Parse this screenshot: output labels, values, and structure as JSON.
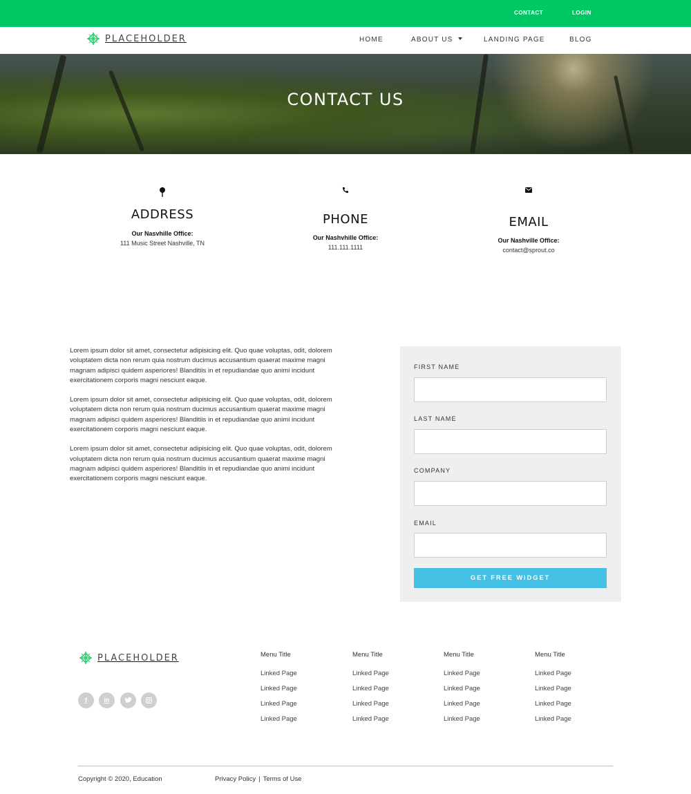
{
  "topbar": {
    "contact": "CONTACT",
    "login": "LOGIN",
    "color": "#00c864"
  },
  "brand": {
    "name": "PLACEHOLDER",
    "accent": "#2ecc71"
  },
  "nav": {
    "home": "HOME",
    "about": "ABOUT US",
    "landing": "LANDING PAGE",
    "blog": "BLOG"
  },
  "hero": {
    "title": "CONTACT US"
  },
  "info": [
    {
      "icon": "map-pin-icon",
      "title": "ADDRESS",
      "label": "Our Nasvhille Office:",
      "value": "111 Music Street Nashville, TN"
    },
    {
      "icon": "phone-icon",
      "title": "PHONE",
      "label": "Our Nashvhille Office:",
      "value": "111.111.1111"
    },
    {
      "icon": "envelope-icon",
      "title": "EMAIL",
      "label": "Our Nashville Office:",
      "value": "contact@sprout.co"
    }
  ],
  "copy": {
    "p1": "Lorem ipsum dolor sit amet, consectetur adipisicing elit. Quo quae voluptas, odit, dolorem voluptatem dicta non rerum quia nostrum ducimus accusantium quaerat maxime magni magnam adipisci quidem asperiores! Blanditiis in et repudiandae quo animi incidunt exercitationem corporis magni nesciunt eaque.",
    "p2": "Lorem ipsum dolor sit amet, consectetur adipisicing elit. Quo quae voluptas, odit, dolorem voluptatem dicta non rerum quia nostrum ducimus accusantium quaerat maxime magni magnam adipisci quidem asperiores! Blanditiis in et repudiandae quo animi incidunt exercitationem corporis magni nesciunt eaque.",
    "p3": "Lorem ipsum dolor sit amet, consectetur adipisicing elit. Quo quae voluptas, odit, dolorem voluptatem dicta non rerum quia nostrum ducimus accusantium quaerat maxime magni magnam adipisci quidem asperiores! Blanditiis in et repudiandae quo animi incidunt exercitationem corporis magni nesciunt eaque."
  },
  "form": {
    "first_name_label": "FIRST NAME",
    "first_name_value": "",
    "last_name_label": "LAST NAME",
    "last_name_value": "",
    "company_label": "COMPANY",
    "company_value": "",
    "email_label": "EMAIL",
    "email_value": "",
    "submit": "GET FREE WIDGET",
    "button_color": "#44c0e4"
  },
  "footer": {
    "social": [
      {
        "icon": "facebook-icon",
        "glyph": "f"
      },
      {
        "icon": "linkedin-icon",
        "glyph": "in"
      },
      {
        "icon": "twitter-icon",
        "glyph": ""
      },
      {
        "icon": "instagram-icon",
        "glyph": ""
      }
    ],
    "columns": [
      {
        "title": "Menu Title",
        "links": [
          "Linked Page",
          "Linked Page",
          "Linked Page",
          "Linked Page"
        ]
      },
      {
        "title": "Menu Title",
        "links": [
          "Linked Page",
          "Linked Page",
          "Linked Page",
          "Linked Page"
        ]
      },
      {
        "title": "Menu Title",
        "links": [
          "Linked Page",
          "Linked Page",
          "Linked Page",
          "Linked Page"
        ]
      },
      {
        "title": "Menu Title",
        "links": [
          "Linked Page",
          "Linked Page",
          "Linked Page",
          "Linked Page"
        ]
      }
    ],
    "copyright": "Copyright © 2020, Education",
    "privacy": "Privacy Policy",
    "separator": "|",
    "terms": "Terms of Use"
  }
}
